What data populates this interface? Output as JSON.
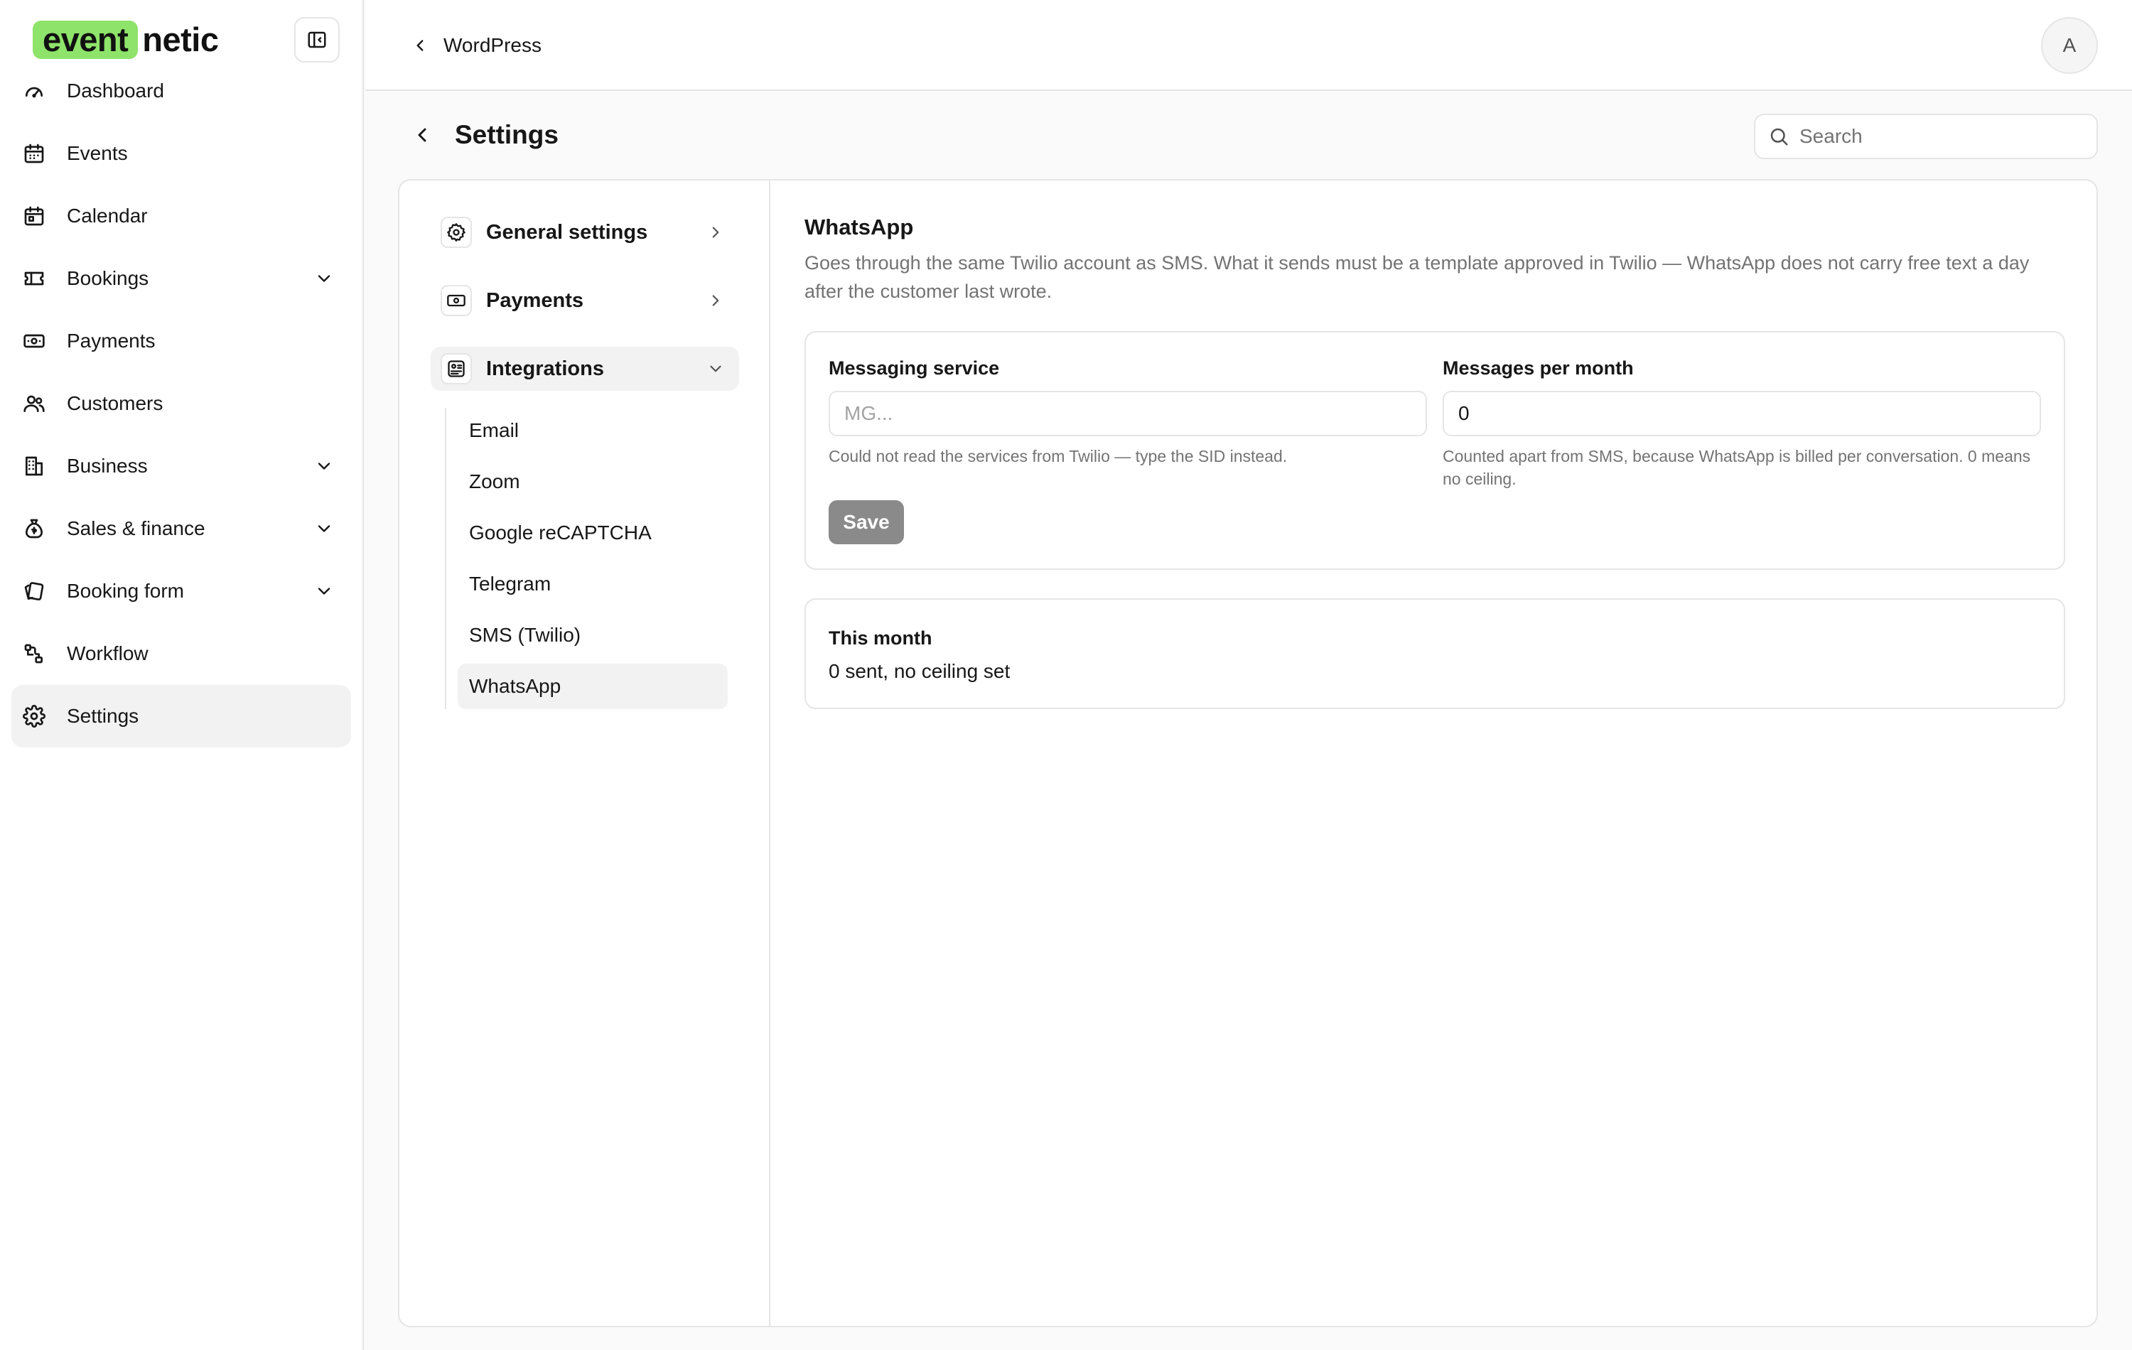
{
  "brand": {
    "mark": "event",
    "rest": "netic",
    "accent": "#8ee36a"
  },
  "sidebar": {
    "items": [
      {
        "label": "Dashboard",
        "icon": "gauge-icon"
      },
      {
        "label": "Events",
        "icon": "calendar-icon"
      },
      {
        "label": "Calendar",
        "icon": "calendar-grid-icon"
      },
      {
        "label": "Bookings",
        "icon": "ticket-icon",
        "expandable": true
      },
      {
        "label": "Payments",
        "icon": "banknote-icon"
      },
      {
        "label": "Customers",
        "icon": "users-icon"
      },
      {
        "label": "Business",
        "icon": "building-icon",
        "expandable": true
      },
      {
        "label": "Sales & finance",
        "icon": "money-bag-icon",
        "expandable": true
      },
      {
        "label": "Booking form",
        "icon": "cards-icon",
        "expandable": true
      },
      {
        "label": "Workflow",
        "icon": "workflow-icon"
      },
      {
        "label": "Settings",
        "icon": "gear-icon",
        "active": true
      }
    ]
  },
  "topbar": {
    "back_label": "WordPress",
    "avatar_initial": "A"
  },
  "page": {
    "title": "Settings",
    "search_placeholder": "Search"
  },
  "settings_nav": {
    "general": "General settings",
    "payments": "Payments",
    "integrations": "Integrations",
    "sub_items": [
      "Email",
      "Zoom",
      "Google reCAPTCHA",
      "Telegram",
      "SMS (Twilio)",
      "WhatsApp"
    ],
    "active_sub": "WhatsApp"
  },
  "whatsapp": {
    "title": "WhatsApp",
    "description": "Goes through the same Twilio account as SMS. What it sends must be a template approved in Twilio — WhatsApp does not carry free text a day after the customer last wrote.",
    "messaging_service": {
      "label": "Messaging service",
      "value": "",
      "placeholder": "MG...",
      "help": "Could not read the services from Twilio — type the SID instead."
    },
    "messages_per_month": {
      "label": "Messages per month",
      "value": "0",
      "help": "Counted apart from SMS, because WhatsApp is billed per conversation. 0 means no ceiling."
    },
    "save_label": "Save",
    "stats": {
      "title": "This month",
      "value": "0 sent, no ceiling set"
    }
  }
}
